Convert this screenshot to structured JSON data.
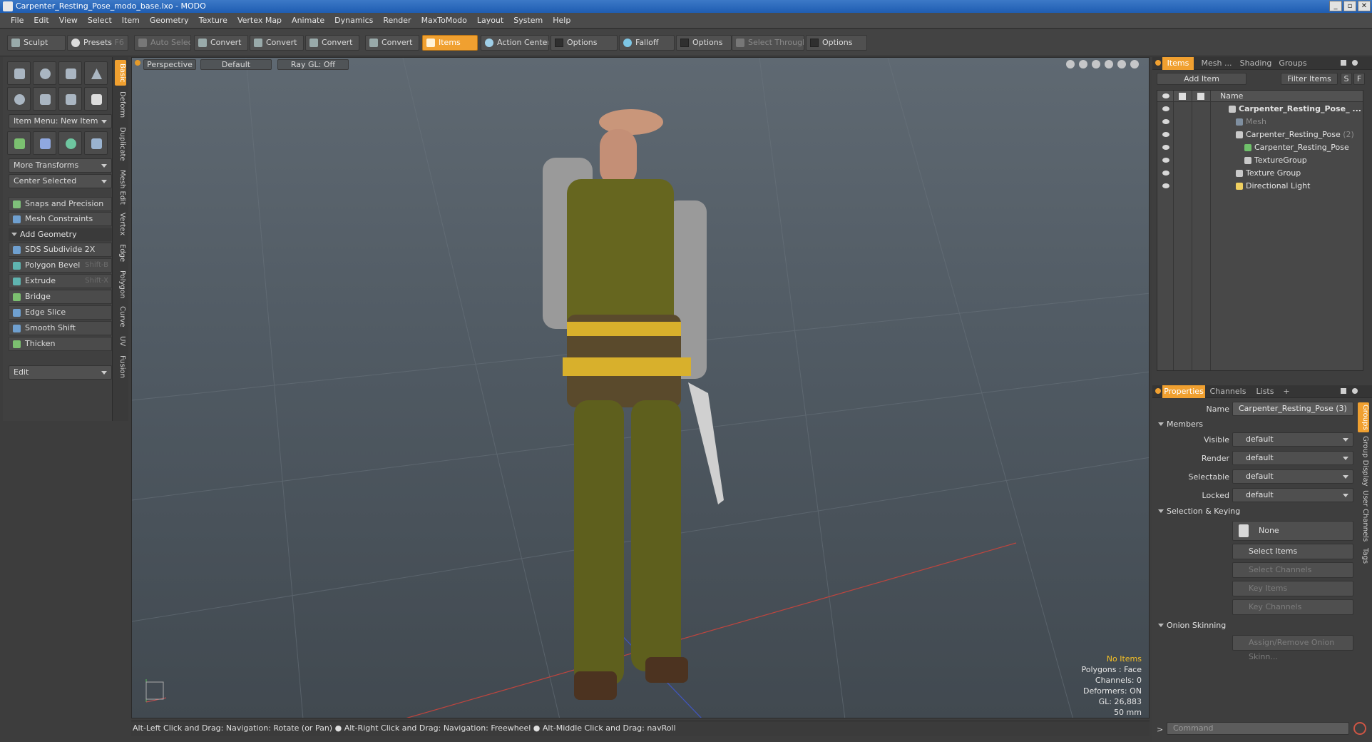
{
  "window": {
    "title": "Carpenter_Resting_Pose_modo_base.lxo - MODO",
    "controls": [
      "_",
      "▫",
      "✕"
    ]
  },
  "menu": [
    "File",
    "Edit",
    "View",
    "Select",
    "Item",
    "Geometry",
    "Texture",
    "Vertex Map",
    "Animate",
    "Dynamics",
    "Render",
    "MaxToModo",
    "Layout",
    "System",
    "Help"
  ],
  "toolbar": {
    "sculpt": "Sculpt",
    "presets": "Presets",
    "presets_key": "F6",
    "auto_select": "Auto Select",
    "convert1": "Convert",
    "convert2": "Convert",
    "convert3": "Convert",
    "convert4": "Convert",
    "items": "Items",
    "action_center": "Action Center",
    "options1": "Options",
    "falloff": "Falloff",
    "options2": "Options",
    "select_through": "Select Through",
    "options3": "Options"
  },
  "left": {
    "item_menu": "Item Menu: New Item",
    "more_transforms": "More Transforms",
    "center_selected": "Center Selected",
    "snaps": "Snaps and Precision",
    "mesh_constraints": "Mesh Constraints",
    "add_geometry": "Add Geometry",
    "tools": [
      {
        "label": "SDS Subdivide 2X",
        "shortcut": ""
      },
      {
        "label": "Polygon Bevel",
        "shortcut": "Shift-B"
      },
      {
        "label": "Extrude",
        "shortcut": "Shift-X"
      },
      {
        "label": "Bridge",
        "shortcut": ""
      },
      {
        "label": "Edge Slice",
        "shortcut": ""
      },
      {
        "label": "Smooth Shift",
        "shortcut": ""
      },
      {
        "label": "Thicken",
        "shortcut": ""
      }
    ],
    "edit": "Edit",
    "vtabs": [
      "Basic",
      "Deform",
      "Duplicate",
      "Mesh Edit",
      "Vertex",
      "Edge",
      "Polygon",
      "Curve",
      "UV",
      "Fusion"
    ]
  },
  "viewport": {
    "perspective": "Perspective",
    "default": "Default",
    "raygl": "Ray GL: Off",
    "stats": {
      "no_items": "No Items",
      "polygons": "Polygons : Face",
      "channels": "Channels: 0",
      "deformers": "Deformers: ON",
      "gl": "GL: 26,883",
      "scale": "50 mm"
    }
  },
  "status": "Alt-Left Click and Drag: Navigation: Rotate (or Pan) ● Alt-Right Click and Drag: Navigation: Freewheel ● Alt-Middle Click and Drag: navRoll",
  "right": {
    "tabs_top": [
      "Items",
      "Mesh ...",
      "Shading",
      "Groups"
    ],
    "add_item": "Add Item",
    "filter_items": "Filter Items",
    "s": "S",
    "f": "F",
    "col_name": "Name",
    "items": [
      {
        "label": "Carpenter_Resting_Pose_ ...",
        "count": "",
        "bold": true,
        "dim": false
      },
      {
        "label": "Mesh",
        "count": "",
        "bold": false,
        "dim": true
      },
      {
        "label": "Carpenter_Resting_Pose",
        "count": "(2)",
        "bold": false,
        "dim": false
      },
      {
        "label": "Carpenter_Resting_Pose",
        "count": "",
        "bold": false,
        "dim": false
      },
      {
        "label": "TextureGroup",
        "count": "",
        "bold": false,
        "dim": false
      },
      {
        "label": "Texture Group",
        "count": "",
        "bold": false,
        "dim": false
      },
      {
        "label": "Directional Light",
        "count": "",
        "bold": false,
        "dim": false
      }
    ],
    "tabs_bottom": [
      "Properties",
      "Channels",
      "Lists",
      "+"
    ],
    "name_label": "Name",
    "name_value": "Carpenter_Resting_Pose (3)",
    "members": "Members",
    "visible_label": "Visible",
    "visible": "default",
    "render_label": "Render",
    "render": "default",
    "selectable_label": "Selectable",
    "selectable": "default",
    "locked_label": "Locked",
    "locked": "default",
    "sel_keying": "Selection & Keying",
    "none": "None",
    "select_items": "Select Items",
    "select_channels": "Select Channels",
    "key_items": "Key Items",
    "key_channels": "Key Channels",
    "onion": "Onion Skinning",
    "assign_onion": "Assign/Remove Onion Skinn...",
    "rvtabs": [
      "Groups",
      "Group Display",
      "User Channels",
      "Tags"
    ],
    "command": "Command"
  }
}
